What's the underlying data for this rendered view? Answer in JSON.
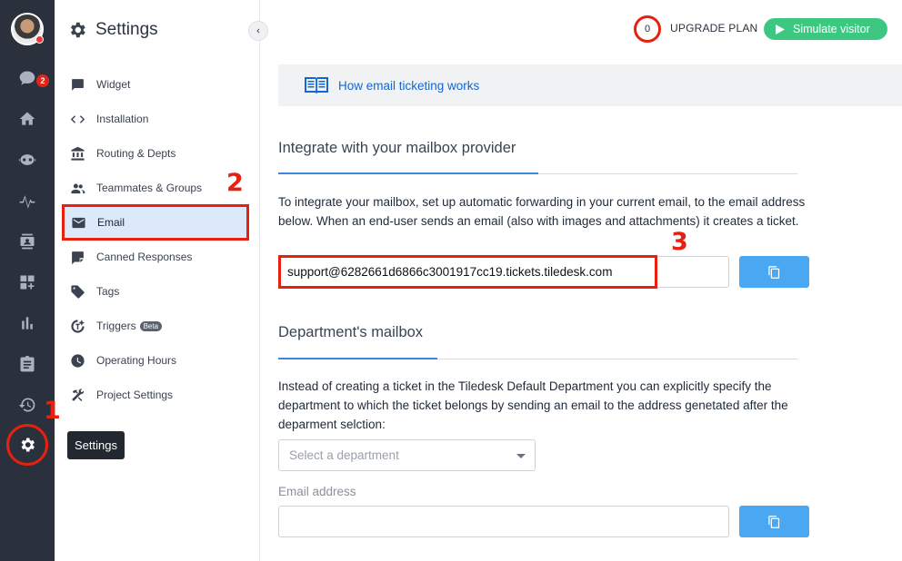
{
  "rail": {
    "chat_badge": "2",
    "items": [
      {
        "icon": "chat-icon"
      },
      {
        "icon": "home-icon"
      },
      {
        "icon": "bot-icon"
      },
      {
        "icon": "activity-icon"
      },
      {
        "icon": "contacts-icon"
      },
      {
        "icon": "apps-icon"
      },
      {
        "icon": "analytics-icon"
      },
      {
        "icon": "clipboard-icon"
      },
      {
        "icon": "history-icon"
      },
      {
        "icon": "settings-icon"
      }
    ]
  },
  "sidebar": {
    "title": "Settings",
    "items": [
      {
        "label": "Widget",
        "icon": "widget-icon"
      },
      {
        "label": "Installation",
        "icon": "code-icon"
      },
      {
        "label": "Routing & Depts",
        "icon": "bank-icon"
      },
      {
        "label": "Teammates & Groups",
        "icon": "people-icon"
      },
      {
        "label": "Email",
        "icon": "mail-icon",
        "active": true
      },
      {
        "label": "Canned Responses",
        "icon": "canned-icon"
      },
      {
        "label": "Tags",
        "icon": "tag-icon"
      },
      {
        "label": "Triggers",
        "icon": "trigger-icon",
        "badge": "Beta"
      },
      {
        "label": "Operating Hours",
        "icon": "clock-icon"
      },
      {
        "label": "Project Settings",
        "icon": "tools-icon"
      }
    ]
  },
  "tooltip": "Settings",
  "annotations": {
    "one": "1",
    "two": "2",
    "three": "3"
  },
  "topbar": {
    "counter": "0",
    "upgrade_label": "UPGRADE PLAN",
    "simulate_label": "Simulate visitor"
  },
  "main": {
    "info_link": "How email ticketing works",
    "section1": {
      "title": "Integrate with your mailbox provider",
      "description": "To integrate your mailbox, set up automatic forwarding in your current email, to the email address below. When an end-user sends an email (also with images and attachments) it creates a ticket.",
      "email": "support@6282661d6866c3001917cc19.tickets.tiledesk.com"
    },
    "section2": {
      "title": "Department's mailbox",
      "description": "Instead of creating a ticket in the Tiledesk Default Department you can explicitly specify the department to which the ticket belongs by sending an email to the address genetated after the deparment selction:",
      "select_placeholder": "Select a department",
      "email_label": "Email address",
      "email_value": ""
    }
  },
  "colors": {
    "rail_bg": "#2a313d",
    "accent_blue": "#1366d6",
    "copy_button": "#4aa8f3",
    "simulate_button": "#3dc882",
    "annotation_red": "#e8200f",
    "active_nav_bg": "#dbe9fb"
  }
}
